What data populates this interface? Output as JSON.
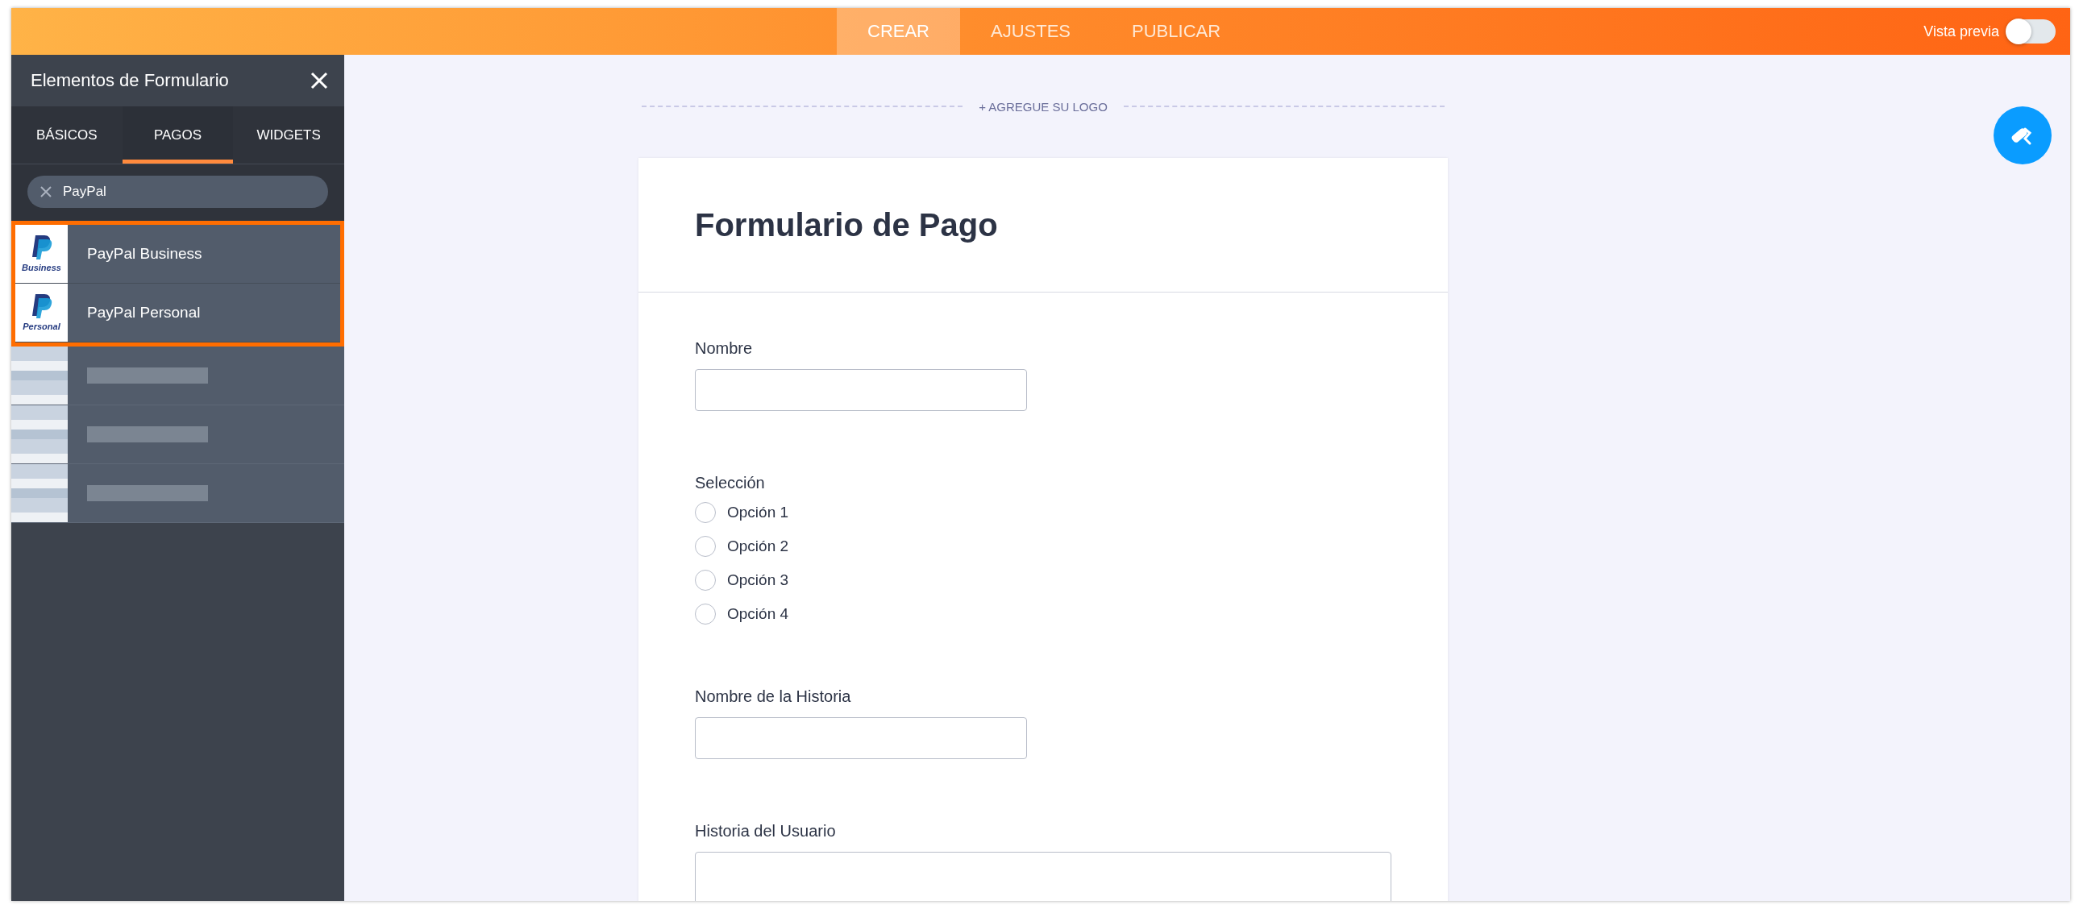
{
  "top_bar": {
    "tabs": [
      {
        "label": "CREAR",
        "selected": true
      },
      {
        "label": "AJUSTES",
        "selected": false
      },
      {
        "label": "PUBLICAR",
        "selected": false
      }
    ],
    "preview_toggle": {
      "label": "Vista previa",
      "on": false
    }
  },
  "sidebar": {
    "title": "Elementos de Formulario",
    "tabs": [
      {
        "label": "BÁSICOS",
        "selected": false
      },
      {
        "label": "PAGOS",
        "selected": true
      },
      {
        "label": "WIDGETS",
        "selected": false
      }
    ],
    "search": {
      "value": "PayPal"
    },
    "items": [
      {
        "kind": "paypal",
        "label": "PayPal Business",
        "caption": "Business",
        "highlighted": true
      },
      {
        "kind": "paypal",
        "label": "PayPal Personal",
        "caption": "Personal",
        "highlighted": true
      },
      {
        "kind": "blurred",
        "highlighted": false
      },
      {
        "kind": "blurred",
        "highlighted": false
      },
      {
        "kind": "blurred",
        "highlighted": false
      }
    ]
  },
  "form": {
    "logo_prompt": "+ AGREGUE SU LOGO",
    "title": "Formulario de Pago",
    "fields": [
      {
        "kind": "text",
        "label": "Nombre"
      },
      {
        "kind": "radio",
        "label": "Selección",
        "options": [
          {
            "label": "Opción 1",
            "selected": false
          },
          {
            "label": "Opción 2",
            "selected": false
          },
          {
            "label": "Opción 3",
            "selected": false
          },
          {
            "label": "Opción 4",
            "selected": false
          }
        ]
      },
      {
        "kind": "text",
        "label": "Nombre de la Historia"
      },
      {
        "kind": "textarea",
        "label": "Historia del Usuario"
      }
    ]
  }
}
